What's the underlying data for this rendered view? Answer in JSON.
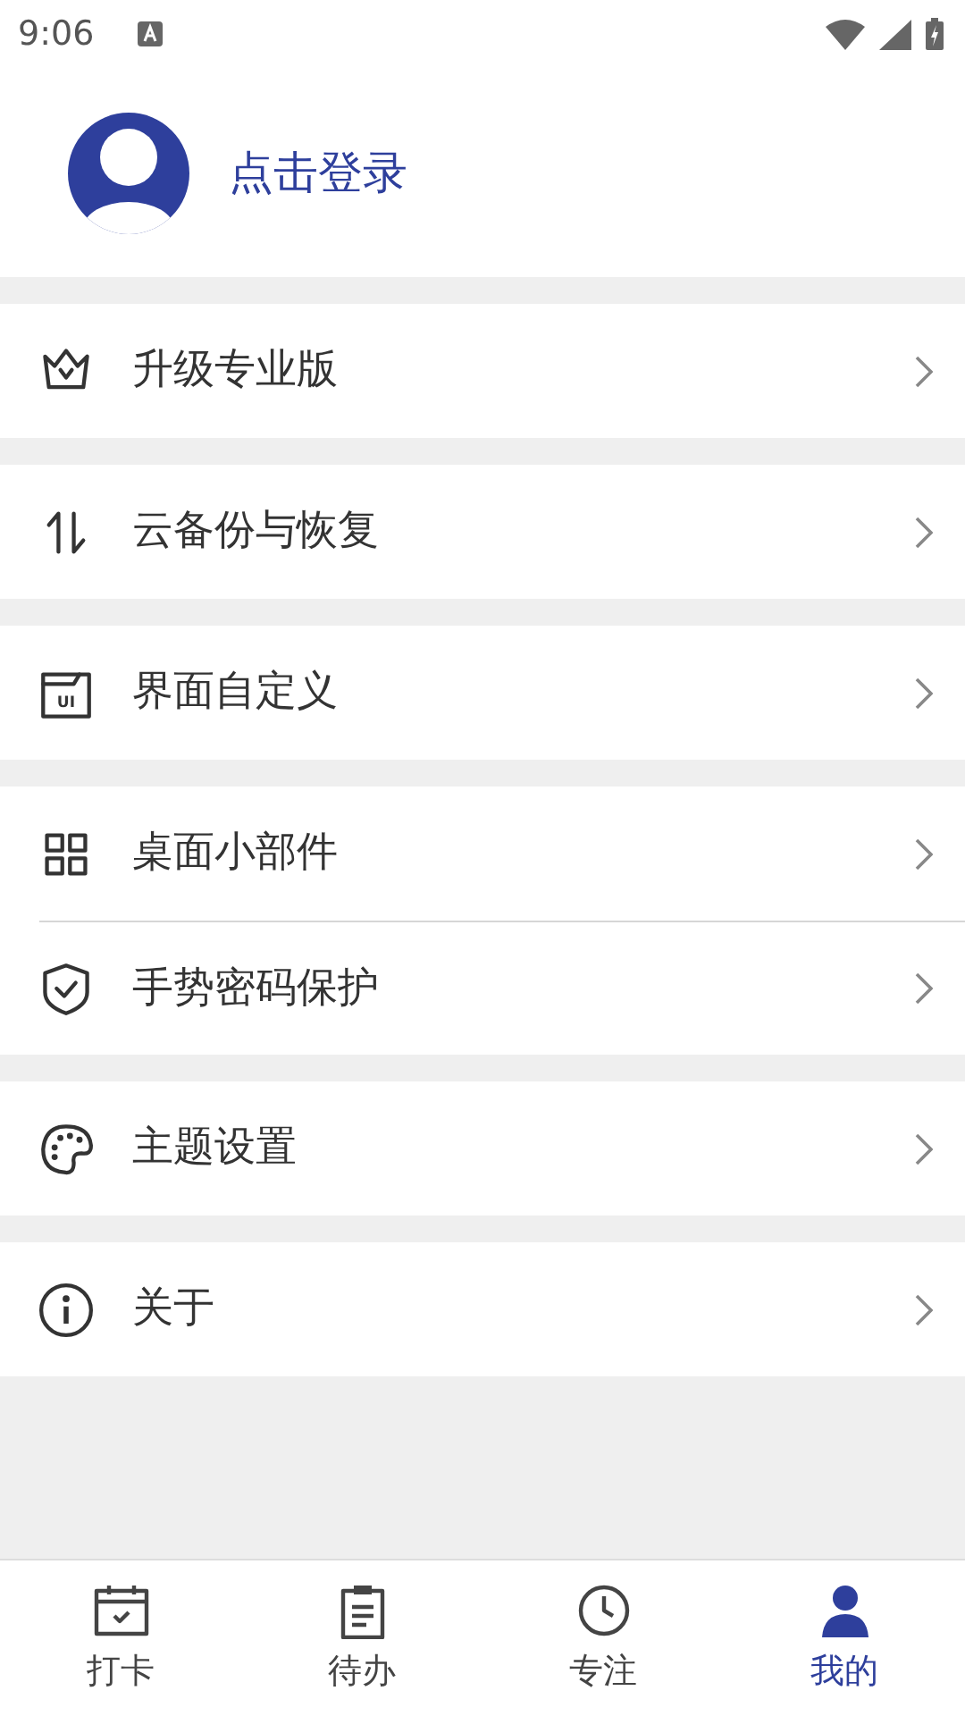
{
  "status_bar": {
    "time": "9:06"
  },
  "profile": {
    "login": "点击登录"
  },
  "menu_groups": [
    {
      "items": [
        {
          "label": "升级专业版"
        }
      ]
    },
    {
      "items": [
        {
          "label": "云备份与恢复"
        }
      ]
    },
    {
      "items": [
        {
          "label": "界面自定义",
          "icon_text": "UI"
        }
      ]
    },
    {
      "items": [
        {
          "label": "桌面小部件"
        },
        {
          "label": "手势密码保护"
        }
      ]
    },
    {
      "items": [
        {
          "label": "主题设置"
        }
      ]
    },
    {
      "items": [
        {
          "label": "关于"
        }
      ]
    }
  ],
  "tabs": [
    {
      "label": "打卡",
      "selected": false
    },
    {
      "label": "待办",
      "selected": false
    },
    {
      "label": "专注",
      "selected": false
    },
    {
      "label": "我的",
      "selected": true
    }
  ]
}
